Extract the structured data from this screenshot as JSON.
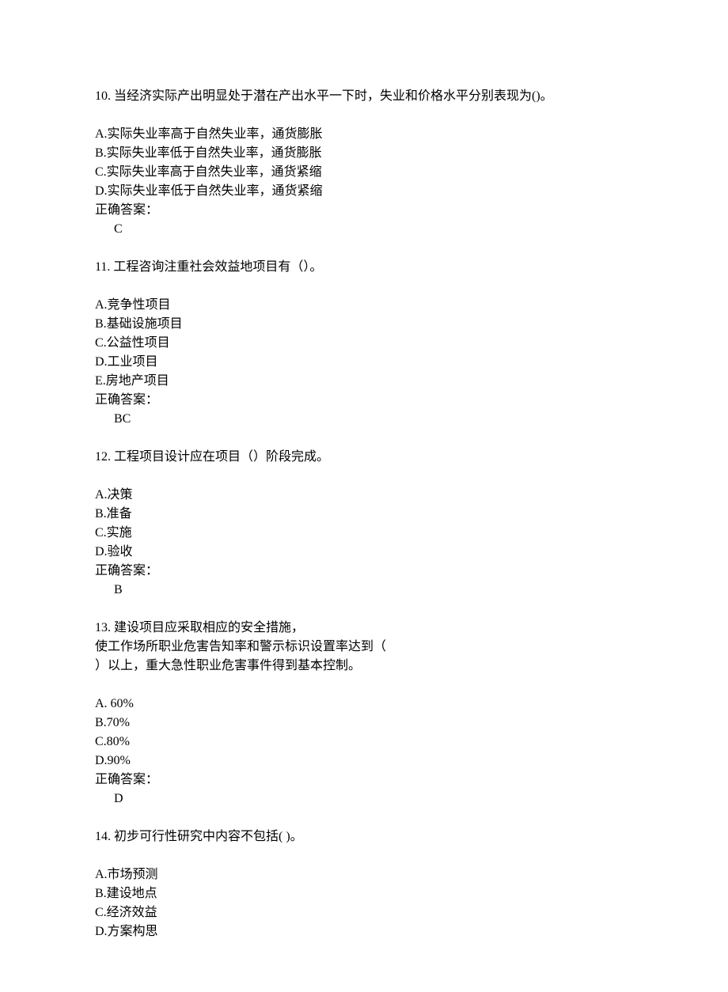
{
  "questions": [
    {
      "number": "10.",
      "text": " 当经济实际产出明显处于潜在产出水平一下时，失业和价格水平分别表现为()。",
      "options": [
        "A.实际失业率高于自然失业率，通货膨胀",
        "B.实际失业率低于自然失业率，通货膨胀",
        "C.实际失业率高于自然失业率，通货紧缩",
        "D.实际失业率低于自然失业率，通货紧缩"
      ],
      "answerLabel": "正确答案：",
      "answerValue": "C"
    },
    {
      "number": "11.",
      "text": " 工程咨询注重社会效益地项目有（）。",
      "options": [
        "A.竞争性项目",
        "B.基础设施项目",
        "C.公益性项目",
        "D.工业项目",
        "E.房地产项目"
      ],
      "answerLabel": "正确答案：",
      "answerValue": "BC"
    },
    {
      "number": "12.",
      "text": " 工程项目设计应在项目（）阶段完成。",
      "options": [
        "A.决策",
        "B.准备",
        "C.实施",
        "D.验收"
      ],
      "answerLabel": "正确答案：",
      "answerValue": "B"
    },
    {
      "number": "13.",
      "text": " 建设项目应采取相应的安全措施，",
      "extraLines": [
        "使工作场所职业危害告知率和警示标识设置率达到（",
        "）以上，重大急性职业危害事件得到基本控制。"
      ],
      "options": [
        "A. 60%",
        "B.70%",
        "C.80%",
        "D.90%"
      ],
      "answerLabel": "正确答案：",
      "answerValue": "D"
    },
    {
      "number": "14.",
      "text": " 初步可行性研究中内容不包括( )。",
      "options": [
        "A.市场预测",
        "B.建设地点",
        "C.经济效益",
        "D.方案构思"
      ],
      "answerLabel": "",
      "answerValue": ""
    }
  ]
}
